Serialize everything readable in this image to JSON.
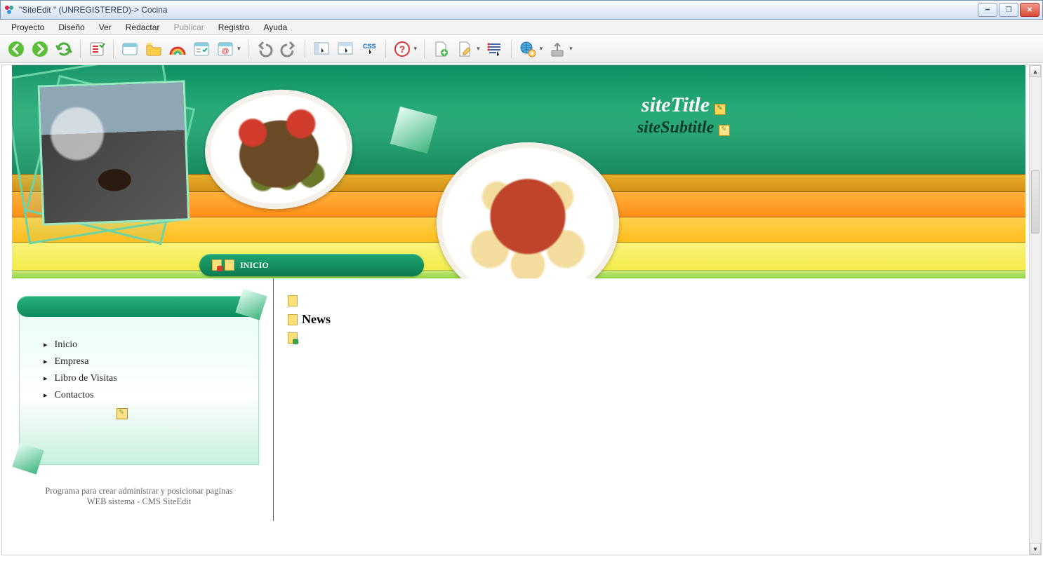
{
  "window": {
    "title": "\"SiteEdit \" (UNREGISTERED)-> Cocina"
  },
  "menu": {
    "items": [
      "Proyecto",
      "Diseño",
      "Ver",
      "Redactar",
      "Publicar",
      "Registro",
      "Ayuda"
    ],
    "disabled_index": 4
  },
  "toolbar": {
    "icons": [
      "nav-back-icon",
      "nav-forward-icon",
      "refresh-icon",
      "checklist-icon",
      "window-icon",
      "folder-open-icon",
      "rainbow-icon",
      "form-check-icon",
      "at-mail-icon",
      "undo-icon",
      "redo-icon",
      "cursor-frame-left-icon",
      "cursor-frame-right-icon",
      "css-cursor-icon",
      "help-icon",
      "page-add-icon",
      "page-edit-icon",
      "list-cursor-icon",
      "globe-gear-icon",
      "upload-icon"
    ]
  },
  "site": {
    "title": "siteTitle",
    "subtitle": "siteSubtitle"
  },
  "breadcrumb": {
    "label": "INICIO"
  },
  "sidebar": {
    "nav": [
      "Inicio",
      "Empresa",
      "Libro de Visitas",
      "Contactos"
    ]
  },
  "tagline": "Programa para crear administrar y posicionar paginas WEB sistema - CMS SiteEdit",
  "content": {
    "heading": "News"
  }
}
